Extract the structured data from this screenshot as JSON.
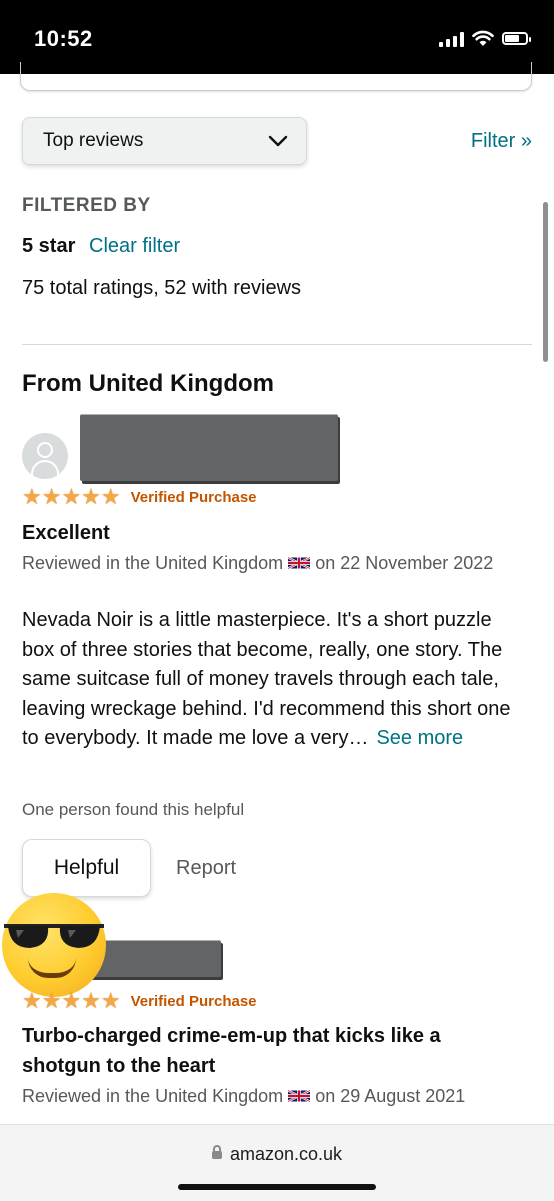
{
  "status_bar": {
    "time": "10:52"
  },
  "sort": {
    "selected": "Top reviews",
    "icon": "chevron-down-icon"
  },
  "filter_link": "Filter »",
  "filtered_by": {
    "heading": "FILTERED BY",
    "star": "5 star",
    "clear": "Clear filter",
    "totals": "75 total ratings, 52 with reviews"
  },
  "region_heading": "From United Kingdom",
  "reviews": [
    {
      "rating": 5,
      "verified": "Verified Purchase",
      "title": "Excellent",
      "meta_prefix": "Reviewed in the United Kingdom",
      "meta_date": "on 22 November 2022",
      "body": "Nevada Noir is a little masterpiece. It's a short puzzle box of three stories that become, really, one story. The same suitcase full of money travels through each tale, leaving wreckage behind. I'd recommend this short one to everybody. It made me love a very…",
      "see_more": "See more",
      "helpful_count": "One person found this helpful",
      "helpful_button": "Helpful",
      "report": "Report"
    },
    {
      "rating": 5,
      "verified": "Verified Purchase",
      "title": "Turbo-charged crime-em-up that kicks like a shotgun to the heart",
      "meta_prefix": "Reviewed in the United Kingdom",
      "meta_date": "on 29 August 2021"
    }
  ],
  "browser": {
    "url": "amazon.co.uk"
  },
  "colors": {
    "link": "#007185",
    "star": "#f3a847",
    "verified": "#c45500"
  }
}
